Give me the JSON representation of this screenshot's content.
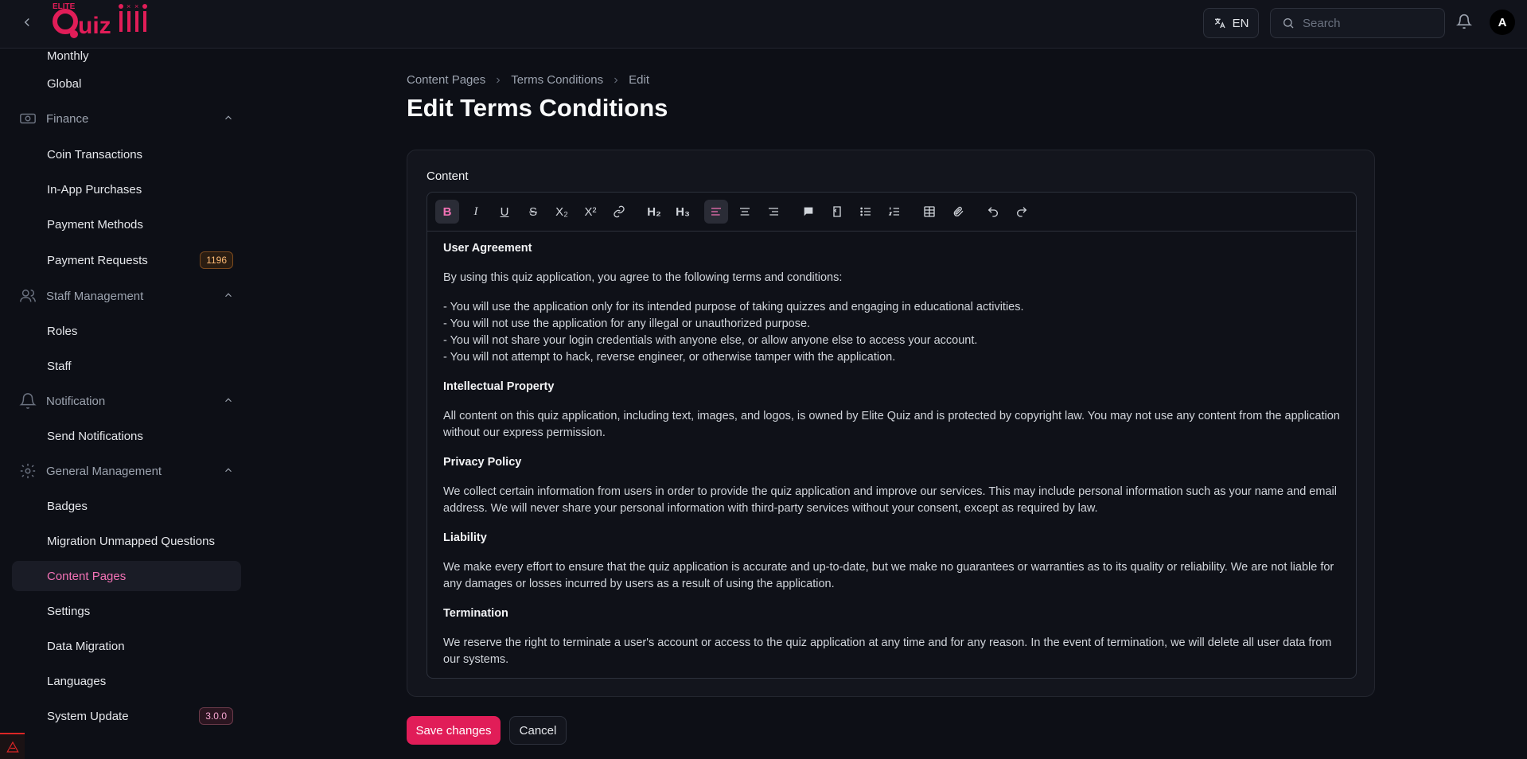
{
  "header": {
    "logo_top_text": "ELITE",
    "logo_text": "Quiz",
    "lang_label": "EN",
    "search_placeholder": "Search",
    "avatar_initial": "A"
  },
  "sidebar": {
    "items_top": [
      {
        "label": "Monthly"
      },
      {
        "label": "Global"
      }
    ],
    "finance": {
      "label": "Finance",
      "items": [
        "Coin Transactions",
        "In-App Purchases",
        "Payment Methods",
        "Payment Requests"
      ],
      "payment_requests_badge": "1196"
    },
    "staff": {
      "label": "Staff Management",
      "items": [
        "Roles",
        "Staff"
      ]
    },
    "notification": {
      "label": "Notification",
      "items": [
        "Send Notifications"
      ]
    },
    "general": {
      "label": "General Management",
      "items": [
        "Badges",
        "Migration Unmapped Questions",
        "Content Pages",
        "Settings",
        "Data Migration",
        "Languages",
        "System Update"
      ],
      "version_badge": "3.0.0"
    }
  },
  "breadcrumb": [
    "Content Pages",
    "Terms Conditions",
    "Edit"
  ],
  "page_title": "Edit Terms Conditions",
  "form": {
    "content_label": "Content",
    "toolbar": {
      "bold": "B",
      "italic": "I",
      "underline": "U",
      "strike": "S",
      "subscript": "X₂",
      "superscript": "X²",
      "h2": "H₂",
      "h3": "H₃"
    },
    "body": {
      "h1": "User Agreement",
      "p1": "By using this quiz application, you agree to the following terms and conditions:",
      "list": [
        "- You will use the application only for its intended purpose of taking quizzes and engaging in educational activities.",
        "- You will not use the application for any illegal or unauthorized purpose.",
        "- You will not share your login credentials with anyone else, or allow anyone else to access your account.",
        "- You will not attempt to hack, reverse engineer, or otherwise tamper with the application."
      ],
      "h2": "Intellectual Property",
      "p2": "All content on this quiz application, including text, images, and logos, is owned by Elite Quiz and is protected by copyright law. You may not use any content from the application without our express permission.",
      "h3": "Privacy Policy",
      "p3": "We collect certain information from users in order to provide the quiz application and improve our services. This may include personal information such as your name and email address. We will never share your personal information with third-party services without your consent, except as required by law.",
      "h4": "Liability",
      "p4": "We make every effort to ensure that the quiz application is accurate and up-to-date, but we make no guarantees or warranties as to its quality or reliability. We are not liable for any damages or losses incurred by users as a result of using the application.",
      "h5": "Termination",
      "p5": "We reserve the right to terminate a user's account or access to the quiz application at any time and for any reason. In the event of termination, we will delete all user data from our systems."
    },
    "save_label": "Save changes",
    "cancel_label": "Cancel"
  },
  "colors": {
    "accent": "#e11d58",
    "active_nav": "#f472b6",
    "background": "#0d0f16"
  }
}
